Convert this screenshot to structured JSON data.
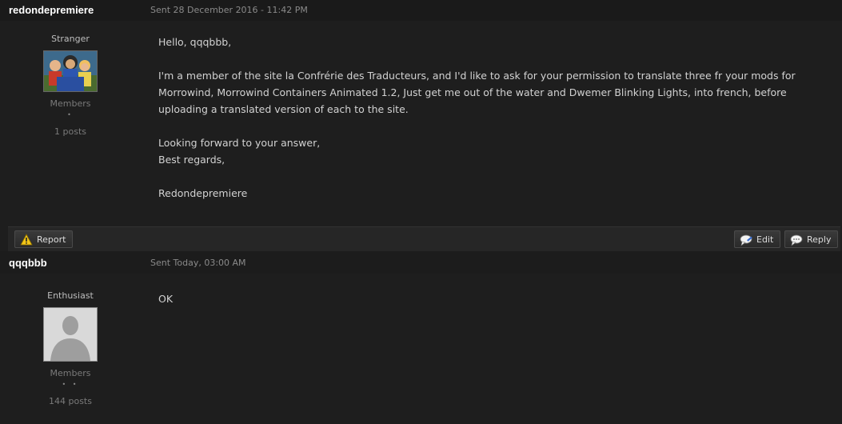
{
  "posts": [
    {
      "author": "redondepremiere",
      "sent": "Sent 28 December 2016 - 11:42 PM",
      "title": "Stranger",
      "group": "Members",
      "pips": "•",
      "post_count": "1 posts",
      "body": [
        "Hello, qqqbbb,",
        "I'm a member of the site la Confrérie des Traducteurs, and I'd like to ask for your permission to translate three fr your mods for Morrowind, Morrowind Containers Animated 1.2, Just get me out of the water and Dwemer Blinking Lights, into french, before uploading a translated version of each to the site.",
        "Looking forward to your answer,",
        "Best regards,",
        "Redondepremiere"
      ],
      "actions": {
        "report": "Report",
        "edit": "Edit",
        "reply": "Reply"
      }
    },
    {
      "author": "qqqbbb",
      "sent": "Sent Today, 03:00 AM",
      "title": "Enthusiast",
      "group": "Members",
      "pips": "• •",
      "post_count": "144 posts",
      "body": [
        "OK"
      ]
    }
  ],
  "icons": {
    "report": "warning-icon",
    "edit": "edit-bubble-icon",
    "reply": "reply-bubble-icon"
  }
}
